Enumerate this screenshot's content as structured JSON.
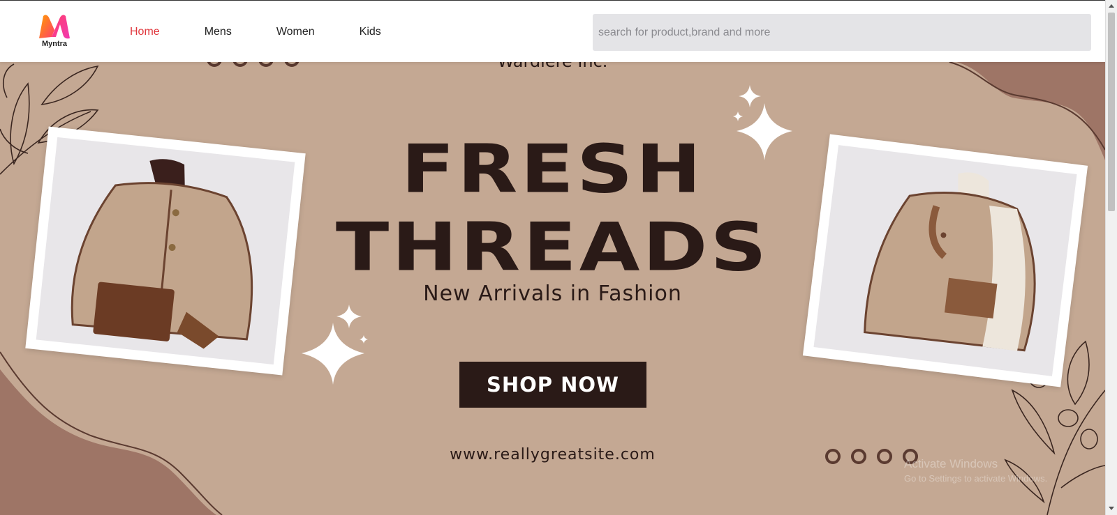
{
  "brand": {
    "name": "Myntra"
  },
  "nav": {
    "items": [
      {
        "label": "Home",
        "active": true
      },
      {
        "label": "Mens",
        "active": false
      },
      {
        "label": "Women",
        "active": false
      },
      {
        "label": "Kids",
        "active": false
      }
    ]
  },
  "search": {
    "placeholder": "search for product,brand and more",
    "value": ""
  },
  "banner": {
    "partial_top_text": "Wardiere Inc.",
    "headline_line1": "FRESH",
    "headline_line2": "THREADS",
    "subtitle": "New Arrivals in Fashion",
    "cta_label": "SHOP NOW",
    "website": "www.reallygreatsite.com"
  },
  "watermark": {
    "line1": "Activate Windows",
    "line2": "Go to Settings to activate Windows."
  },
  "colors": {
    "banner_bg": "#c4a893",
    "dark_brown": "#2a1a17",
    "accent_active_nav": "#e0373d",
    "search_bg": "#e4e4e7"
  },
  "icons": [
    "myntra-logo-icon",
    "sparkle-icon",
    "leaf-branch-icon",
    "olive-branch-icon"
  ]
}
